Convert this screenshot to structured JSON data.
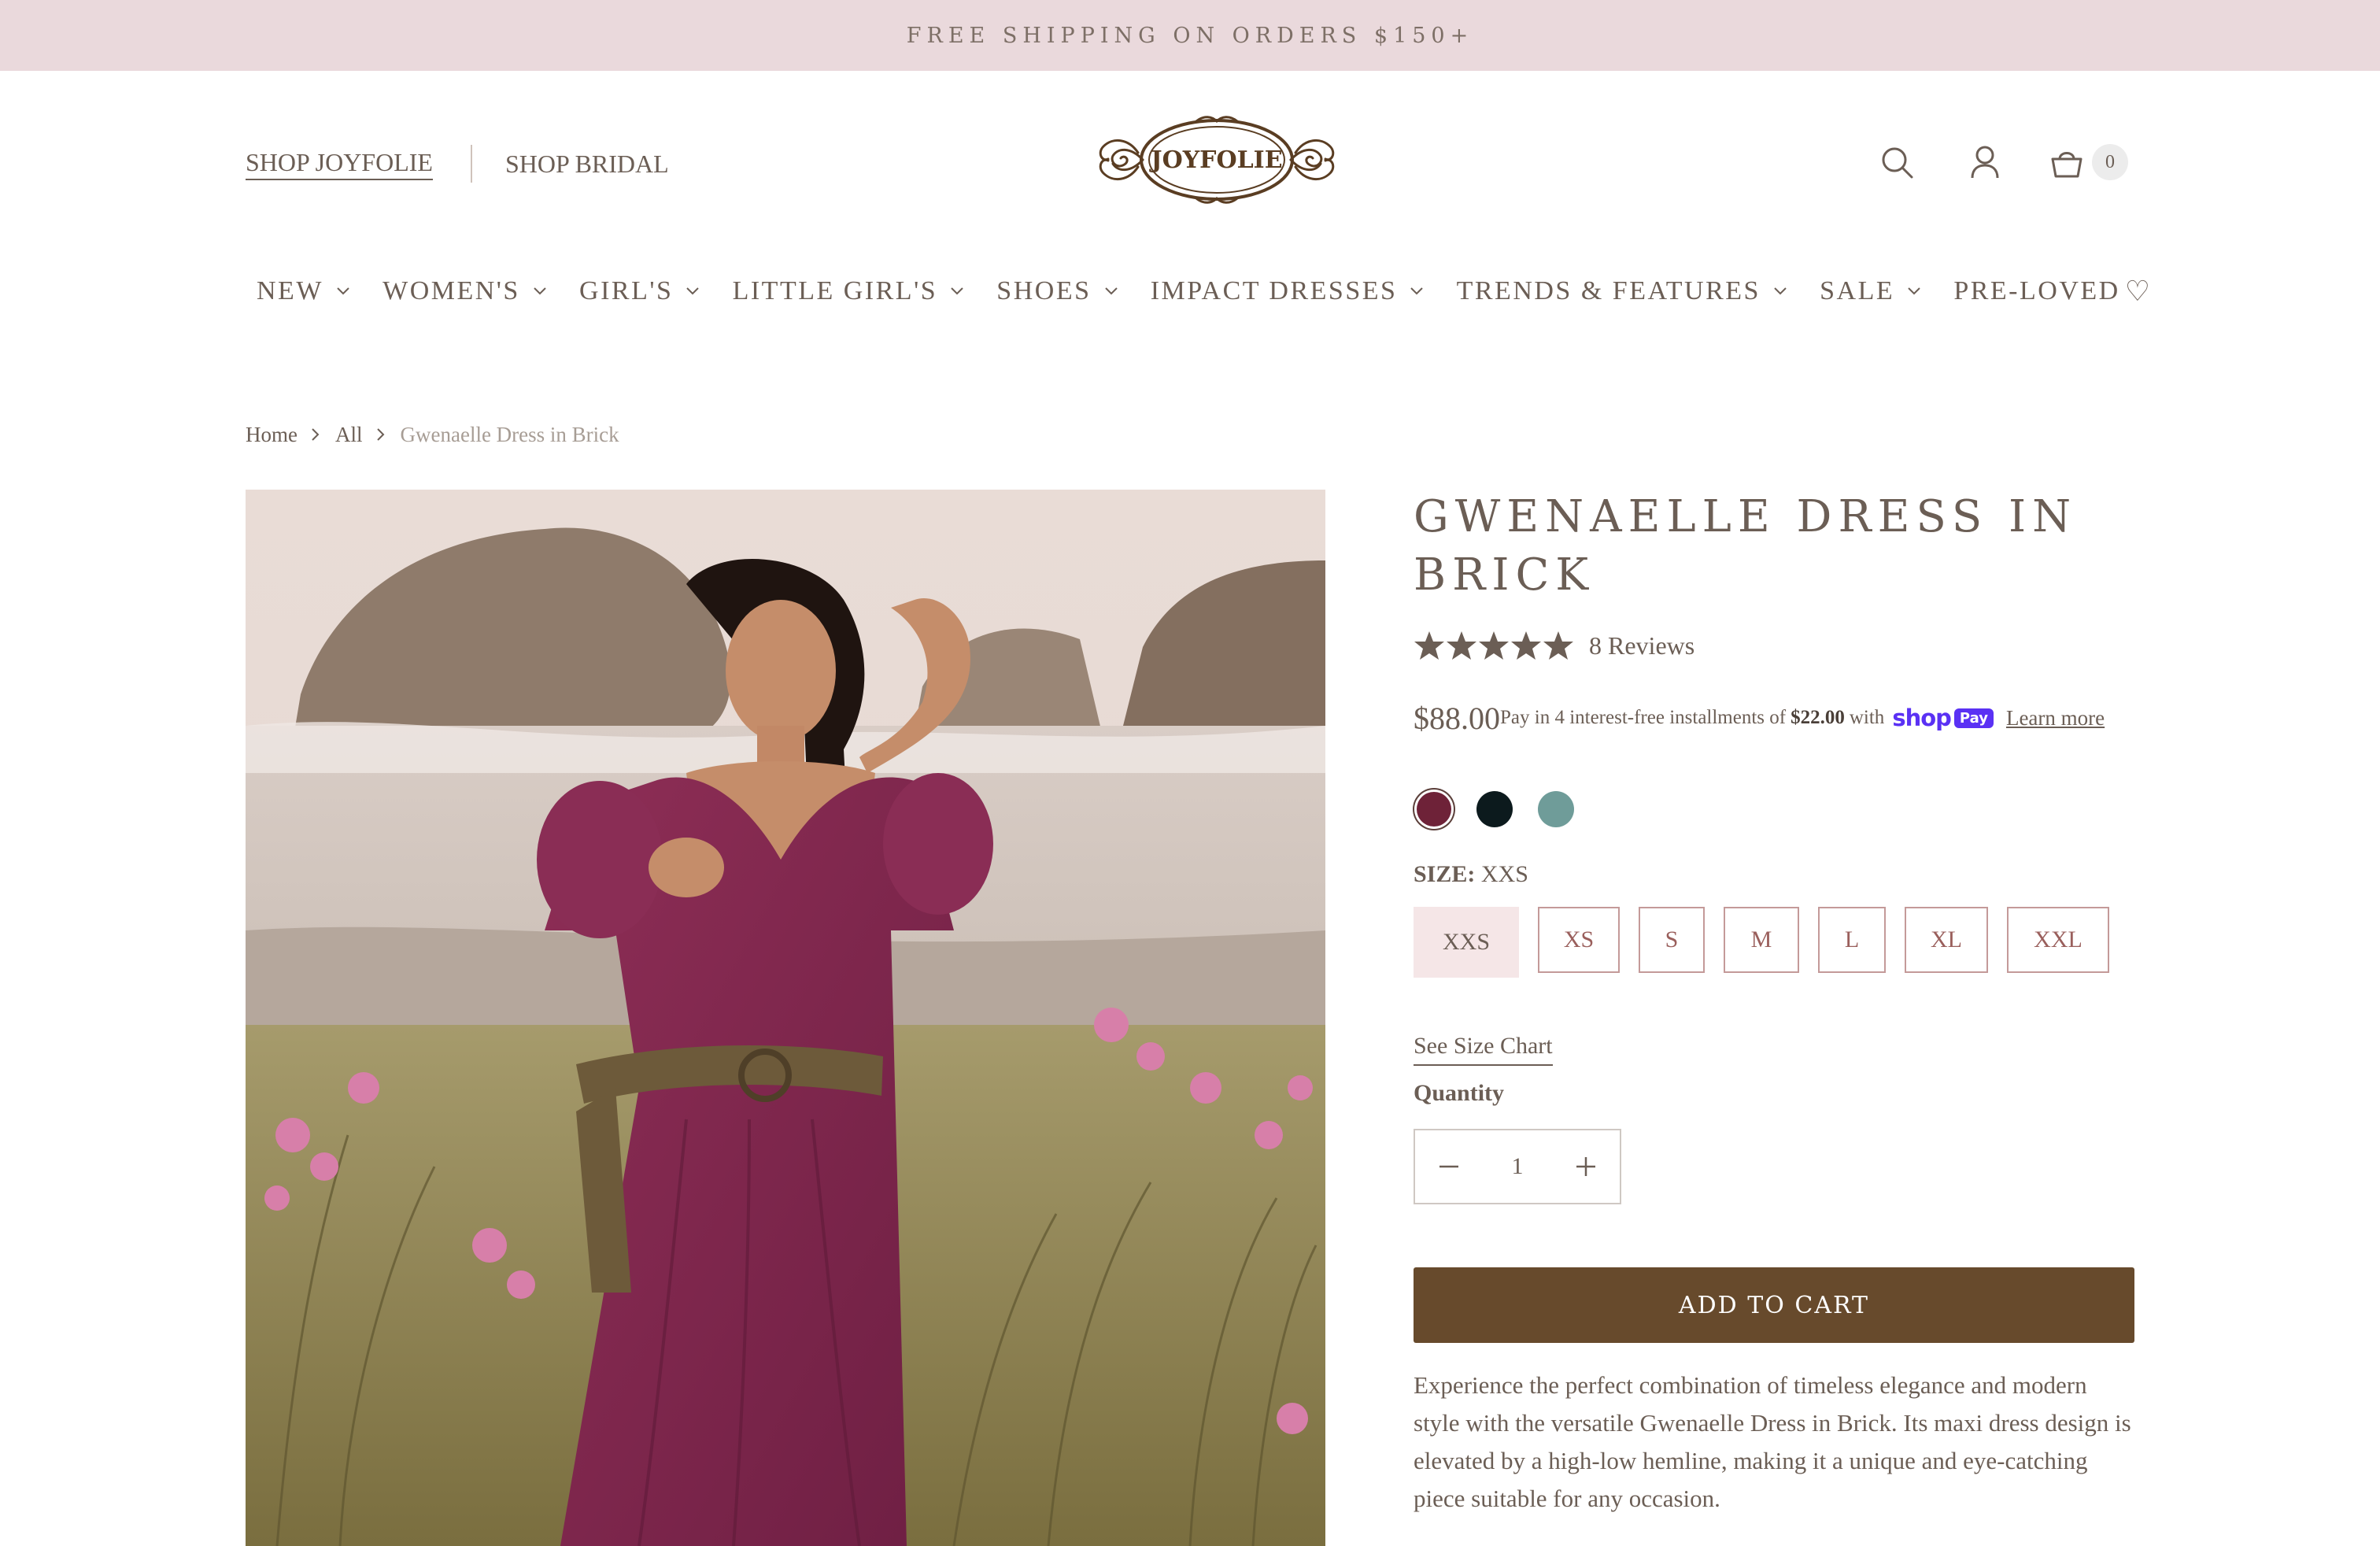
{
  "announcement": "FREE SHIPPING ON ORDERS $150+",
  "header": {
    "links": [
      "SHOP JOYFOLIE",
      "SHOP BRIDAL"
    ],
    "logo_text": "JOYFOLIE",
    "cart_count": "0"
  },
  "nav": {
    "items": [
      {
        "label": "NEW"
      },
      {
        "label": "WOMEN'S"
      },
      {
        "label": "GIRL'S"
      },
      {
        "label": "LITTLE GIRL'S"
      },
      {
        "label": "SHOES"
      },
      {
        "label": "IMPACT DRESSES"
      },
      {
        "label": "TRENDS & FEATURES"
      },
      {
        "label": "SALE"
      },
      {
        "label": "PRE-LOVED"
      }
    ]
  },
  "breadcrumb": [
    "Home",
    "All",
    "Gwenaelle Dress in Brick"
  ],
  "product": {
    "title": "GWENAELLE DRESS IN BRICK",
    "rating": 5,
    "reviews": "8 Reviews",
    "price": "$88.00",
    "installments_prefix": "Pay in 4 interest-free installments of",
    "installments_amount": "$22.00",
    "installments_with": "with",
    "shop_pay_text": "shop",
    "shop_pay_badge": "Pay",
    "learn_more": "Learn more",
    "swatches": [
      {
        "color": "#6e2238",
        "selected": true
      },
      {
        "color": "#0c1a1d",
        "selected": false
      },
      {
        "color": "#6f9c99",
        "selected": false
      }
    ],
    "size_label": "SIZE:",
    "selected_size": "XXS",
    "sizes": [
      "XXS",
      "XS",
      "S",
      "M",
      "L",
      "XL",
      "XXL"
    ],
    "size_chart": "See Size Chart",
    "quantity_label": "Quantity",
    "quantity": "1",
    "add_to_cart": "ADD TO CART",
    "description": "Experience the perfect combination of timeless elegance and modern style with the versatile Gwenaelle Dress in Brick. Its maxi dress design is elevated by a high-low hemline, making it a unique and eye-catching piece suitable for any occasion."
  },
  "colors": {
    "announcement_bg": "#ead9dc",
    "text": "#6b5e55",
    "button_bg": "#674a2c",
    "size_border": "#c49a99",
    "size_selected_bg": "#f5e6e7"
  }
}
